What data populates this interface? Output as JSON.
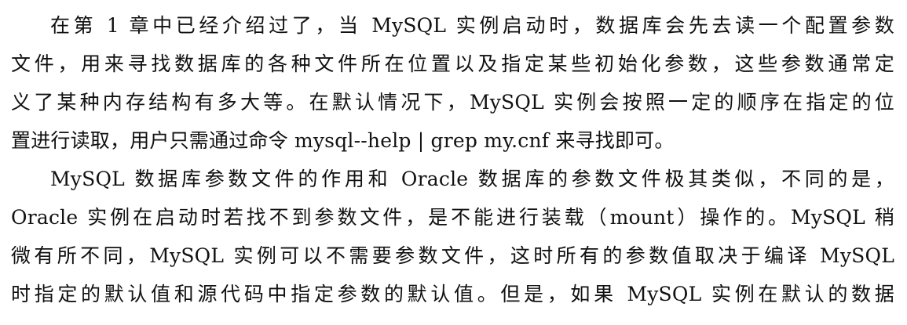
{
  "paragraphs": [
    {
      "lines": [
        "在第 1 章中已经介绍过了，当 MySQL 实例启动时，数据库会先去读一个配置参数",
        "文件，用来寻找数据库的各种文件所在位置以及指定某些初始化参数，这些参数通常定",
        "义了某种内存结构有多大等。在默认情况下，MySQL 实例会按照一定的顺序在指定的位",
        "置进行读取，用户只需通过命令 mysql--help | grep my.cnf 来寻找即可。"
      ]
    },
    {
      "lines": [
        "MySQL 数据库参数文件的作用和 Oracle 数据库的参数文件极其类似，不同的是，",
        "Oracle 实例在启动时若找不到参数文件，是不能进行装载（mount）操作的。MySQL 稍",
        "微有所不同，MySQL 实例可以不需要参数文件，这时所有的参数值取决于编译 MySQL",
        "时指定的默认值和源代码中指定参数的默认值。但是，如果 MySQL 实例在默认的数据"
      ]
    }
  ]
}
